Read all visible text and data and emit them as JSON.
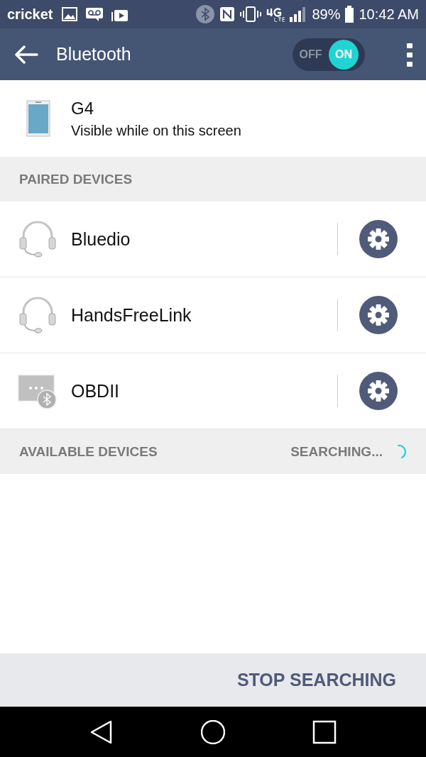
{
  "status_bar": {
    "carrier": "cricket",
    "battery": "89%",
    "time": "10:42 AM"
  },
  "app_bar": {
    "title": "Bluetooth",
    "toggle": {
      "off_label": "OFF",
      "on_label": "ON",
      "on": true
    }
  },
  "this_device": {
    "name": "G4",
    "subtitle": "Visible while on this screen"
  },
  "paired_header": "PAIRED DEVICES",
  "paired_devices": [
    {
      "name": "Bluedio",
      "kind": "headset"
    },
    {
      "name": "HandsFreeLink",
      "kind": "headset"
    },
    {
      "name": "OBDII",
      "kind": "generic"
    }
  ],
  "available_header": {
    "title": "AVAILABLE DEVICES",
    "status": "SEARCHING..."
  },
  "action_button": "STOP SEARCHING"
}
